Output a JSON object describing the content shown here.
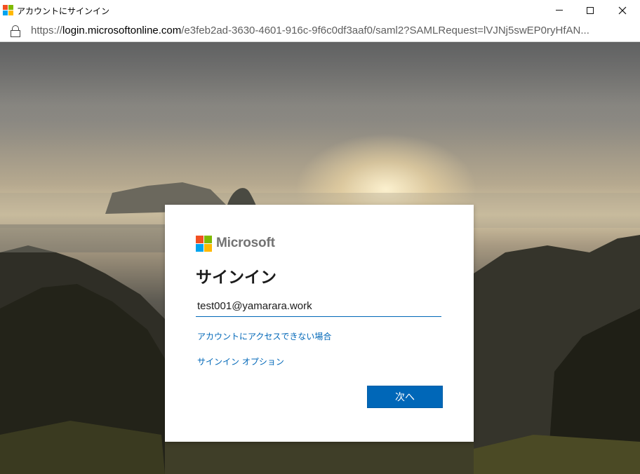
{
  "window": {
    "title": "アカウントにサインイン"
  },
  "address_bar": {
    "scheme": "https://",
    "host": "login.microsoftonline.com",
    "path": "/e3feb2ad-3630-4601-916c-9f6c0df3aaf0/saml2?SAMLRequest=lVJNj5swEP0ryHfAN..."
  },
  "card": {
    "brand": "Microsoft",
    "heading": "サインイン",
    "email_value": "test001@yamarara.work",
    "link_no_access": "アカウントにアクセスできない場合",
    "link_options": "サインイン オプション",
    "next_label": "次へ"
  },
  "colors": {
    "accent": "#0067b8",
    "logo_red": "#f25022",
    "logo_green": "#7fba00",
    "logo_blue": "#00a4ef",
    "logo_yellow": "#ffb900"
  }
}
